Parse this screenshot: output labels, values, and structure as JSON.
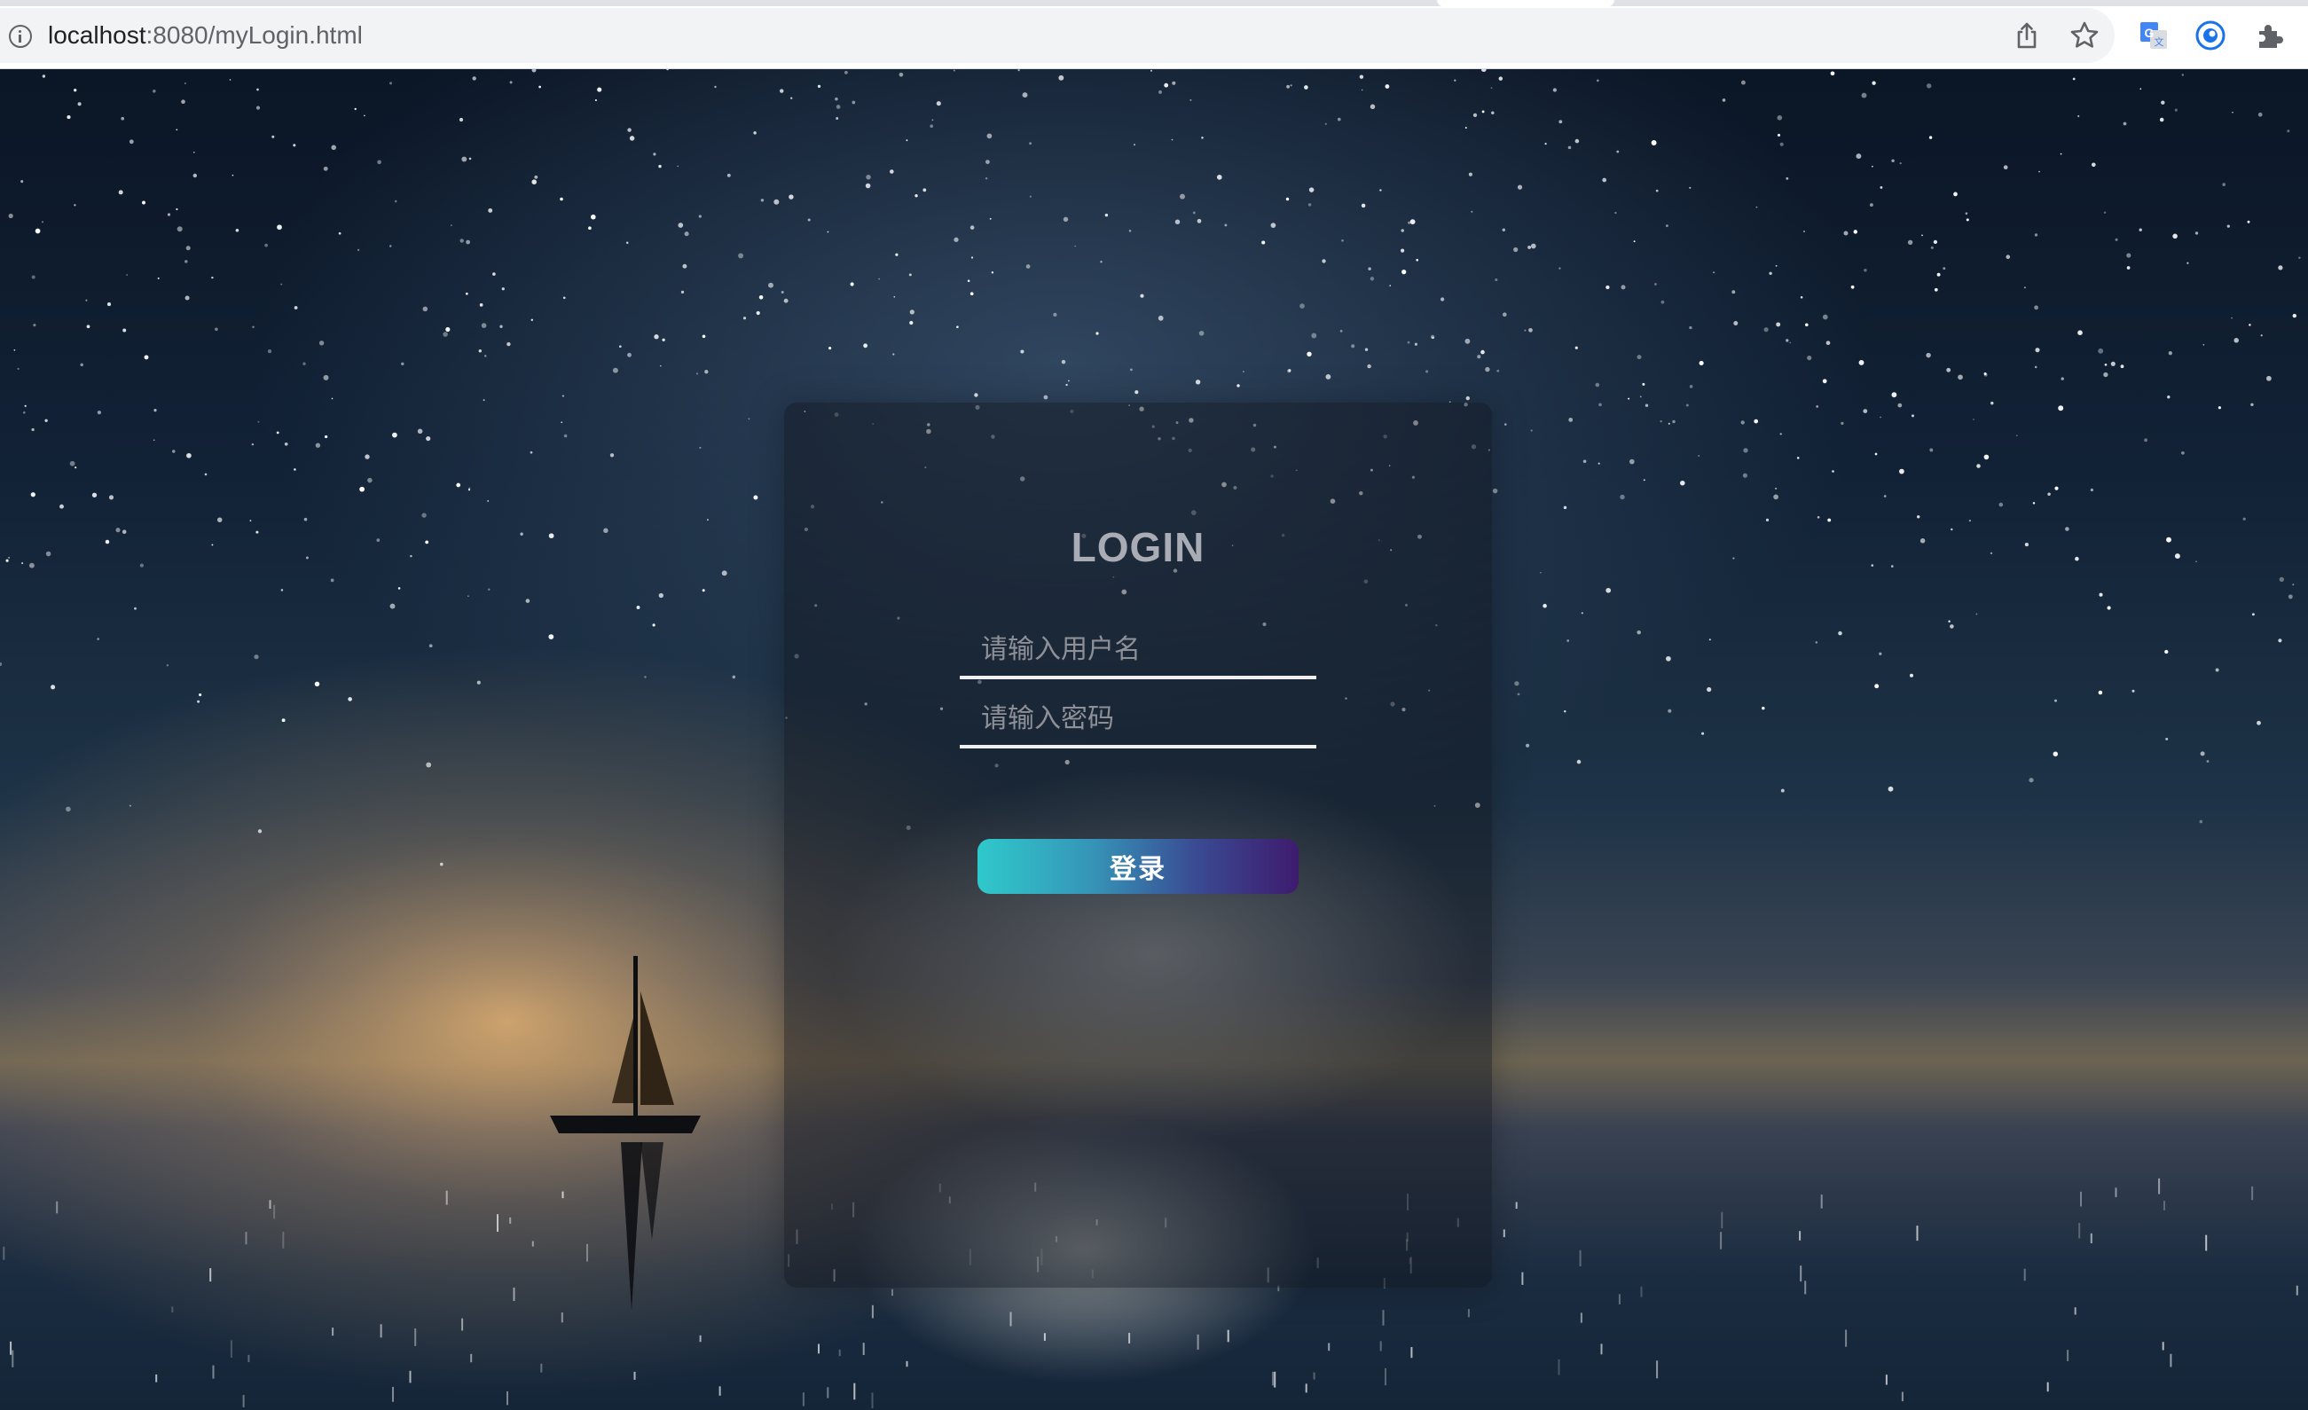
{
  "browser": {
    "url_host": "localhost",
    "url_rest": ":8080/myLogin.html",
    "icons": [
      "info-icon",
      "share-icon",
      "star-icon",
      "translate-icon",
      "extension-eye-icon",
      "puzzle-icon"
    ]
  },
  "login": {
    "title": "LOGIN",
    "username_placeholder": "请输入用户名",
    "username_value": "",
    "password_placeholder": "请输入密码",
    "password_value": "",
    "submit_label": "登录"
  },
  "colors": {
    "button_gradient_start": "#2fc9cb",
    "button_gradient_end": "#3e1b6e",
    "title_color": "#a9acb4",
    "underline_color": "#f0f0f0"
  }
}
